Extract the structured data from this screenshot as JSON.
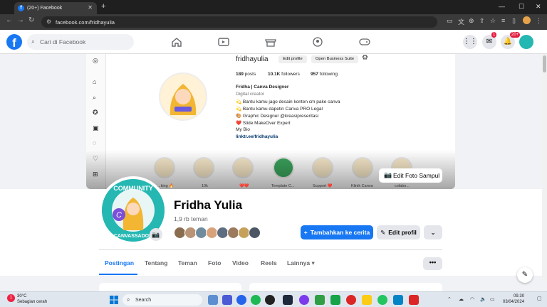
{
  "browser": {
    "tab_title": "(20+) Facebook",
    "url": "facebook.com/fridhayulia",
    "favicon_letter": "f"
  },
  "fb_header": {
    "logo": "f",
    "search_placeholder": "Cari di Facebook",
    "messenger_badge": "1",
    "notifications_badge": "20+"
  },
  "instagram_cover": {
    "username": "fridhayulia",
    "edit_profile": "Edit profile",
    "business_suite": "Open Business Suite",
    "posts": "189",
    "posts_label": "posts",
    "followers": "10.1K",
    "followers_label": "followers",
    "following": "957",
    "following_label": "following",
    "name": "Fridha | Canva Designer",
    "category": "Digital creator",
    "bio_lines": [
      "💫 Bantu kamu jago desain konten cm pake canva",
      "💫 Bantu kamu dapetin Canva PRO Legal",
      "🎨 Graphic Designer @kreasipresentasi",
      "❤️ Slide MakeOver Expert",
      "My Bio"
    ],
    "link": "linktr.ee/fridhayulia",
    "highlights": [
      "...king 🔥",
      "10k",
      "❤️❤️",
      "Template C...",
      "Support ❤️",
      "Klinik Canva",
      "colabo..."
    ]
  },
  "cover_button": "Edit Foto Sampul",
  "profile": {
    "name": "Fridha Yulia",
    "friends": "1,9 rb teman",
    "avatar_ring_top": "COMMUNITY",
    "avatar_ring_bottom": "CANVASSADOR",
    "avatar_letter": "C",
    "add_story": "Tambahkan ke cerita",
    "edit_profile": "Edit profil"
  },
  "tabs": [
    "Postingan",
    "Tentang",
    "Teman",
    "Foto",
    "Video",
    "Reels",
    "Lainnya"
  ],
  "tabs_more": "•••",
  "taskbar": {
    "weather_temp": "30°C",
    "weather_desc": "Sebagian cerah",
    "weather_badge": "1",
    "search": "Search",
    "time": "09.30",
    "date": "03/04/2024"
  },
  "colors": {
    "fb_blue": "#1877f2",
    "badge_red": "#e41e3f",
    "avatar_teal": "#25b7b2"
  }
}
